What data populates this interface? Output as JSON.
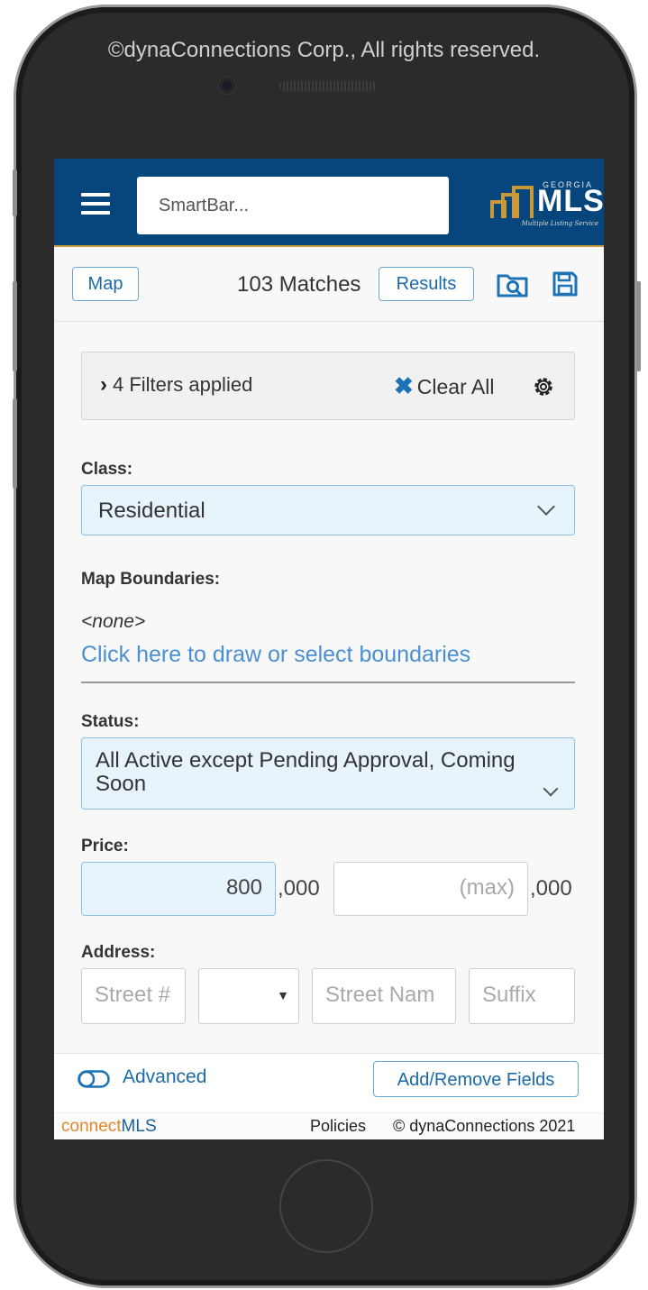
{
  "device": {
    "copyright": "©dynaConnections Corp., All rights reserved."
  },
  "header": {
    "search_placeholder": "SmartBar...",
    "logo_top": "GEORGIA",
    "logo_main": "MLS",
    "logo_sub": "Multiple Listing Service"
  },
  "toolbar": {
    "map_label": "Map",
    "matches": "103 Matches",
    "results_label": "Results"
  },
  "filters": {
    "applied_label": "4 Filters applied",
    "clear_label": "Clear All"
  },
  "form": {
    "class_label": "Class:",
    "class_value": "Residential",
    "boundaries_label": "Map Boundaries:",
    "boundaries_value": "<none>",
    "boundaries_link": "Click here to draw or select boundaries",
    "status_label": "Status:",
    "status_value": "All Active except Pending Approval, Coming Soon",
    "price_label": "Price:",
    "price_min": "800",
    "price_min_suffix": ",000",
    "price_max_placeholder": "(max)",
    "price_max_suffix": ",000",
    "address_label": "Address:",
    "street_number_placeholder": "Street #",
    "street_name_placeholder": "Street Nam",
    "suffix_placeholder": "Suffix"
  },
  "bottom": {
    "advanced_label": "Advanced",
    "add_remove_label": "Add/Remove Fields"
  },
  "footer": {
    "brand_a": "connect",
    "brand_b": "MLS",
    "policies": "Policies",
    "copyright": "© dynaConnections 2021"
  },
  "colors": {
    "header_bg": "#06467c",
    "accent_gold": "#c99a3b",
    "link_blue": "#4a8fd1",
    "field_highlight": "#e8f4fc"
  }
}
